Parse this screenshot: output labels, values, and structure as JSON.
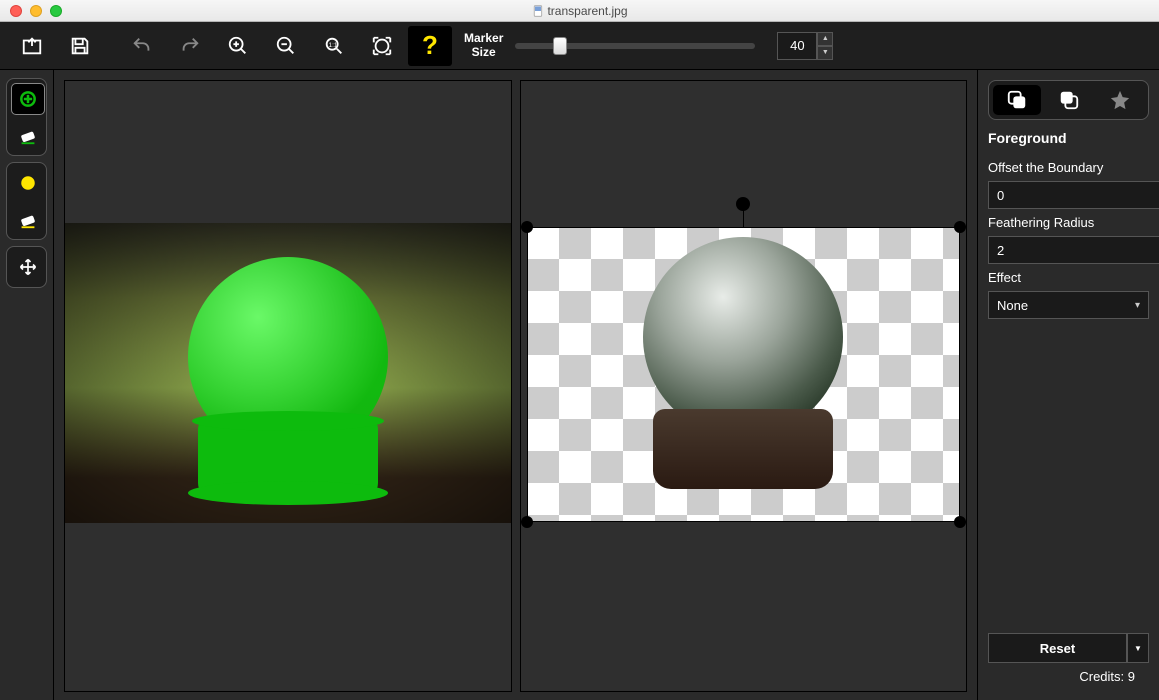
{
  "window": {
    "title": "transparent.jpg"
  },
  "toolbar": {
    "marker_label_line1": "Marker",
    "marker_label_line2": "Size",
    "marker_value": "40"
  },
  "panel": {
    "heading": "Foreground",
    "offset_label": "Offset the Boundary",
    "offset_value": "0",
    "feather_label": "Feathering Radius",
    "feather_value": "2",
    "effect_label": "Effect",
    "effect_value": "None",
    "reset_label": "Reset"
  },
  "footer": {
    "credits_label": "Credits: 9"
  }
}
